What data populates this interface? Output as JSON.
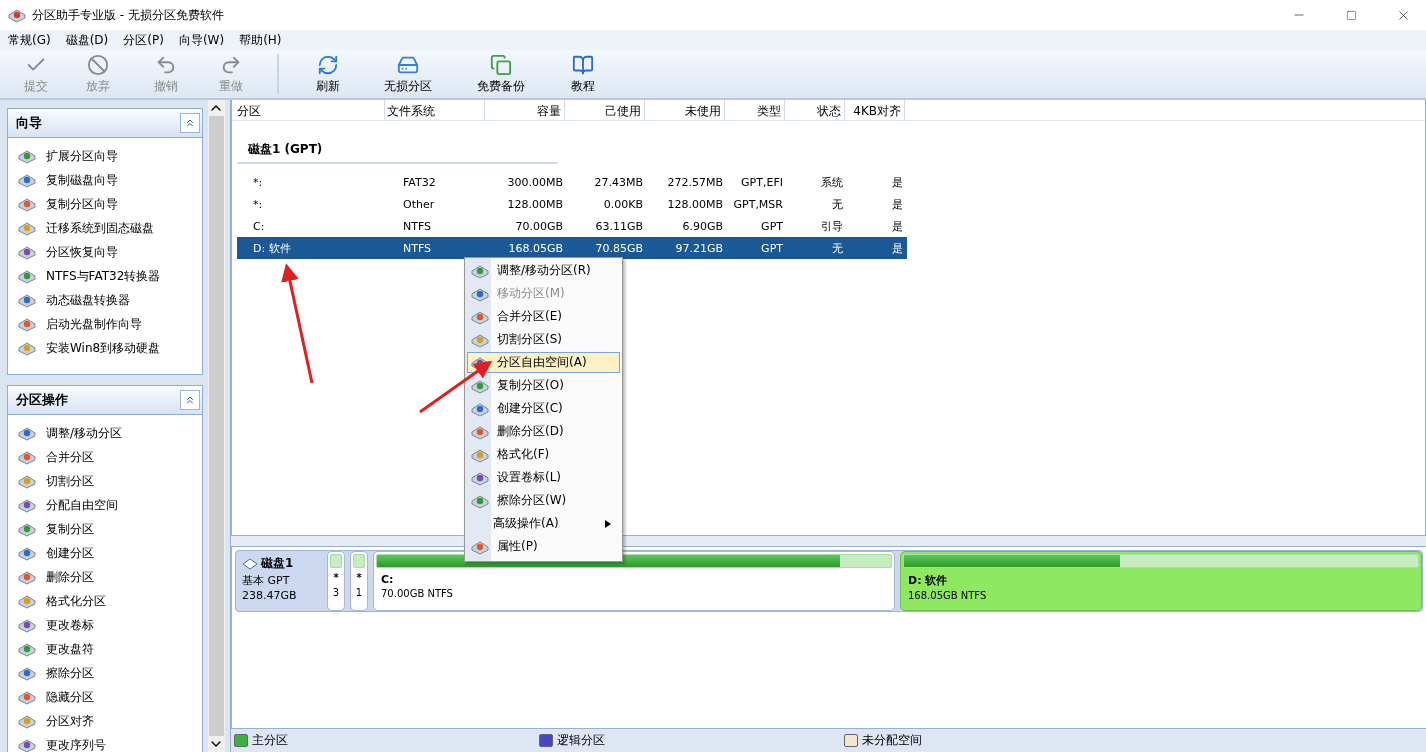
{
  "window": {
    "title": "分区助手专业版 - 无损分区免费软件"
  },
  "menu": [
    "常规(G)",
    "磁盘(D)",
    "分区(P)",
    "向导(W)",
    "帮助(H)"
  ],
  "toolbar": [
    {
      "label": "提交",
      "disabled": true
    },
    {
      "label": "放弃",
      "disabled": true
    },
    {
      "label": "撤销",
      "disabled": true
    },
    {
      "label": "重做",
      "disabled": true
    },
    {
      "label": "刷新",
      "disabled": false
    },
    {
      "label": "无损分区",
      "disabled": false
    },
    {
      "label": "免费备份",
      "disabled": false
    },
    {
      "label": "教程",
      "disabled": false
    }
  ],
  "sidebar": [
    {
      "title": "向导",
      "expanded": true,
      "items": [
        "扩展分区向导",
        "复制磁盘向导",
        "复制分区向导",
        "迁移系统到固态磁盘",
        "分区恢复向导",
        "NTFS与FAT32转换器",
        "动态磁盘转换器",
        "启动光盘制作向导",
        "安装Win8到移动硬盘"
      ]
    },
    {
      "title": "分区操作",
      "expanded": true,
      "items": [
        "调整/移动分区",
        "合并分区",
        "切割分区",
        "分配自由空间",
        "复制分区",
        "创建分区",
        "删除分区",
        "格式化分区",
        "更改卷标",
        "更改盘符",
        "擦除分区",
        "隐藏分区",
        "分区对齐",
        "更改序列号"
      ]
    }
  ],
  "table": {
    "columns": [
      "分区",
      "文件系统",
      "容量",
      "己使用",
      "未使用",
      "类型",
      "状态",
      "4KB对齐"
    ],
    "group": "磁盘1 (GPT)",
    "rows": [
      {
        "cells": [
          "*:",
          "FAT32",
          "300.00MB",
          "27.43MB",
          "272.57MB",
          "GPT,EFI",
          "系统",
          "是"
        ],
        "selected": false
      },
      {
        "cells": [
          "*:",
          "Other",
          "128.00MB",
          "0.00KB",
          "128.00MB",
          "GPT,MSR",
          "无",
          "是"
        ],
        "selected": false
      },
      {
        "cells": [
          "C:",
          "NTFS",
          "70.00GB",
          "63.11GB",
          "6.90GB",
          "GPT",
          "引导",
          "是"
        ],
        "selected": false
      },
      {
        "cells": [
          "D: 软件",
          "NTFS",
          "168.05GB",
          "70.85GB",
          "97.21GB",
          "GPT",
          "无",
          "是"
        ],
        "selected": true
      }
    ]
  },
  "context_menu": [
    {
      "label": "调整/移动分区(R)",
      "kind": "action",
      "disabled": false,
      "selected": false
    },
    {
      "label": "移动分区(M)",
      "kind": "action",
      "disabled": true,
      "selected": false
    },
    {
      "label": "合并分区(E)",
      "kind": "action",
      "disabled": false,
      "selected": false
    },
    {
      "label": "切割分区(S)",
      "kind": "action",
      "disabled": false,
      "selected": false
    },
    {
      "label": "分区自由空间(A)",
      "kind": "action",
      "disabled": false,
      "selected": true
    },
    {
      "label": "复制分区(O)",
      "kind": "action",
      "disabled": false,
      "selected": false
    },
    {
      "label": "创建分区(C)",
      "kind": "action",
      "disabled": false,
      "selected": false
    },
    {
      "label": "删除分区(D)",
      "kind": "action",
      "disabled": false,
      "selected": false
    },
    {
      "label": "格式化(F)",
      "kind": "action",
      "disabled": false,
      "selected": false
    },
    {
      "label": "设置卷标(L)",
      "kind": "action",
      "disabled": false,
      "selected": false
    },
    {
      "label": "擦除分区(W)",
      "kind": "action",
      "disabled": false,
      "selected": false
    },
    {
      "label": "高级操作(A)",
      "kind": "submenu",
      "disabled": false,
      "selected": false
    },
    {
      "label": "属性(P)",
      "kind": "action",
      "disabled": false,
      "selected": false
    }
  ],
  "disk_map": {
    "name": "磁盘1",
    "type": "基本 GPT",
    "size": "238.47GB",
    "partitions": [
      {
        "kind": "small",
        "label": "*",
        "number": "3",
        "selected": false
      },
      {
        "kind": "small",
        "label": "*",
        "number": "1",
        "selected": false
      },
      {
        "kind": "large",
        "label": "C:",
        "detail": "70.00GB NTFS",
        "level": 0.9,
        "selected": false
      },
      {
        "kind": "large",
        "label": "D: 软件",
        "detail": "168.05GB NTFS",
        "level": 0.42,
        "selected": true
      }
    ]
  },
  "legend": [
    {
      "label": "主分区",
      "color": "#3cb43c"
    },
    {
      "label": "逻辑分区",
      "color": "#4646c8"
    },
    {
      "label": "未分配空间",
      "color": "#f0e6d2"
    }
  ]
}
